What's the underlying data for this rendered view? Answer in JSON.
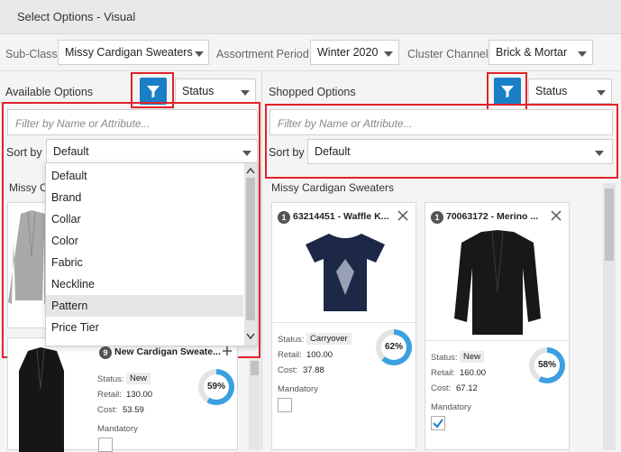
{
  "window": {
    "title": "Select Options - Visual"
  },
  "header": {
    "subclass_label": "Sub-Class",
    "subclass_value": "Missy Cardigan Sweaters",
    "period_label": "Assortment Period",
    "period_value": "Winter 2020",
    "cluster_label": "Cluster Channel",
    "cluster_value": "Brick & Mortar"
  },
  "available": {
    "title": "Available Options",
    "status_label": "Status",
    "filter_placeholder": "Filter by Name or Attribute...",
    "sort_label": "Sort by",
    "sort_value": "Default",
    "section_label": "Missy C",
    "sort_options": [
      "Default",
      "Brand",
      "Collar",
      "Color",
      "Fabric",
      "Neckline",
      "Pattern",
      "Price Tier"
    ],
    "card": {
      "count": "9",
      "name": "New Cardigan Sweate...",
      "status_label": "Status:",
      "status": "New",
      "retail_label": "Retail:",
      "retail": "130.00",
      "cost_label": "Cost:",
      "cost": "53.59",
      "percent": "59%",
      "percent_value": 59,
      "mandatory_label": "Mandatory",
      "mandatory": false
    }
  },
  "shopped": {
    "title": "Shopped Options",
    "status_label": "Status",
    "filter_placeholder": "Filter by Name or Attribute...",
    "sort_label": "Sort by",
    "sort_value": "Default",
    "section_label": "Missy Cardigan Sweaters",
    "cards": [
      {
        "count": "1",
        "name": "63214451 - Waffle K...",
        "status_label": "Status:",
        "status": "Carryover",
        "retail_label": "Retail:",
        "retail": "100.00",
        "cost_label": "Cost:",
        "cost": "37.88",
        "percent": "62%",
        "percent_value": 62,
        "mandatory_label": "Mandatory",
        "mandatory": false
      },
      {
        "count": "1",
        "name": "70063172 - Merino ...",
        "status_label": "Status:",
        "status": "New",
        "retail_label": "Retail:",
        "retail": "160.00",
        "cost_label": "Cost:",
        "cost": "67.12",
        "percent": "58%",
        "percent_value": 58,
        "mandatory_label": "Mandatory",
        "mandatory": true
      }
    ]
  },
  "colors": {
    "accent": "#1a7fc6",
    "highlight": "#e0232b",
    "ring": "#3aa0e0"
  },
  "icons": {
    "filter": "filter-icon",
    "close": "close-icon",
    "plus": "plus-icon",
    "check": "check-icon",
    "caret": "caret-down-icon"
  }
}
